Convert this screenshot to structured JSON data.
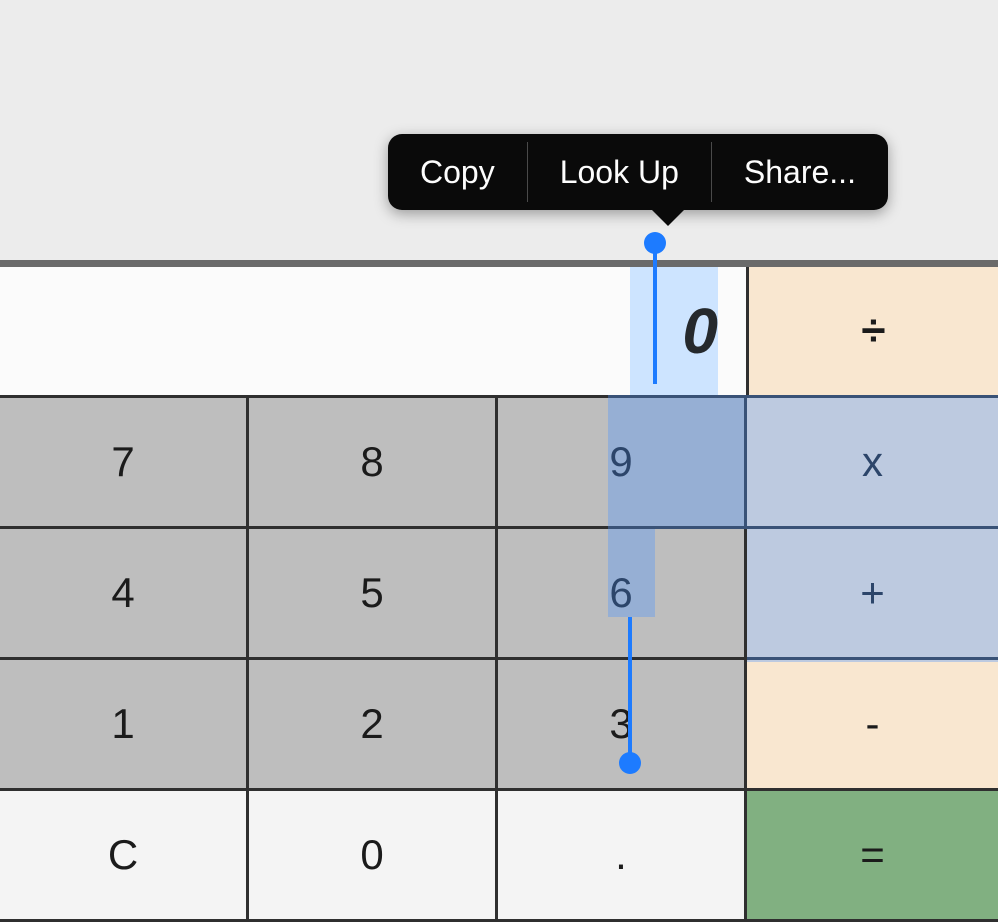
{
  "contextMenu": {
    "copy": "Copy",
    "lookup": "Look Up",
    "share": "Share..."
  },
  "display": {
    "value": "0"
  },
  "ops": {
    "divide": "÷",
    "multiply": "x",
    "plus": "+",
    "minus": "-",
    "equals": "="
  },
  "keys": {
    "k7": "7",
    "k8": "8",
    "k9": "9",
    "k4": "4",
    "k5": "5",
    "k6": "6",
    "k1": "1",
    "k2": "2",
    "k3": "3",
    "clear": "C",
    "k0": "0",
    "dot": "."
  }
}
